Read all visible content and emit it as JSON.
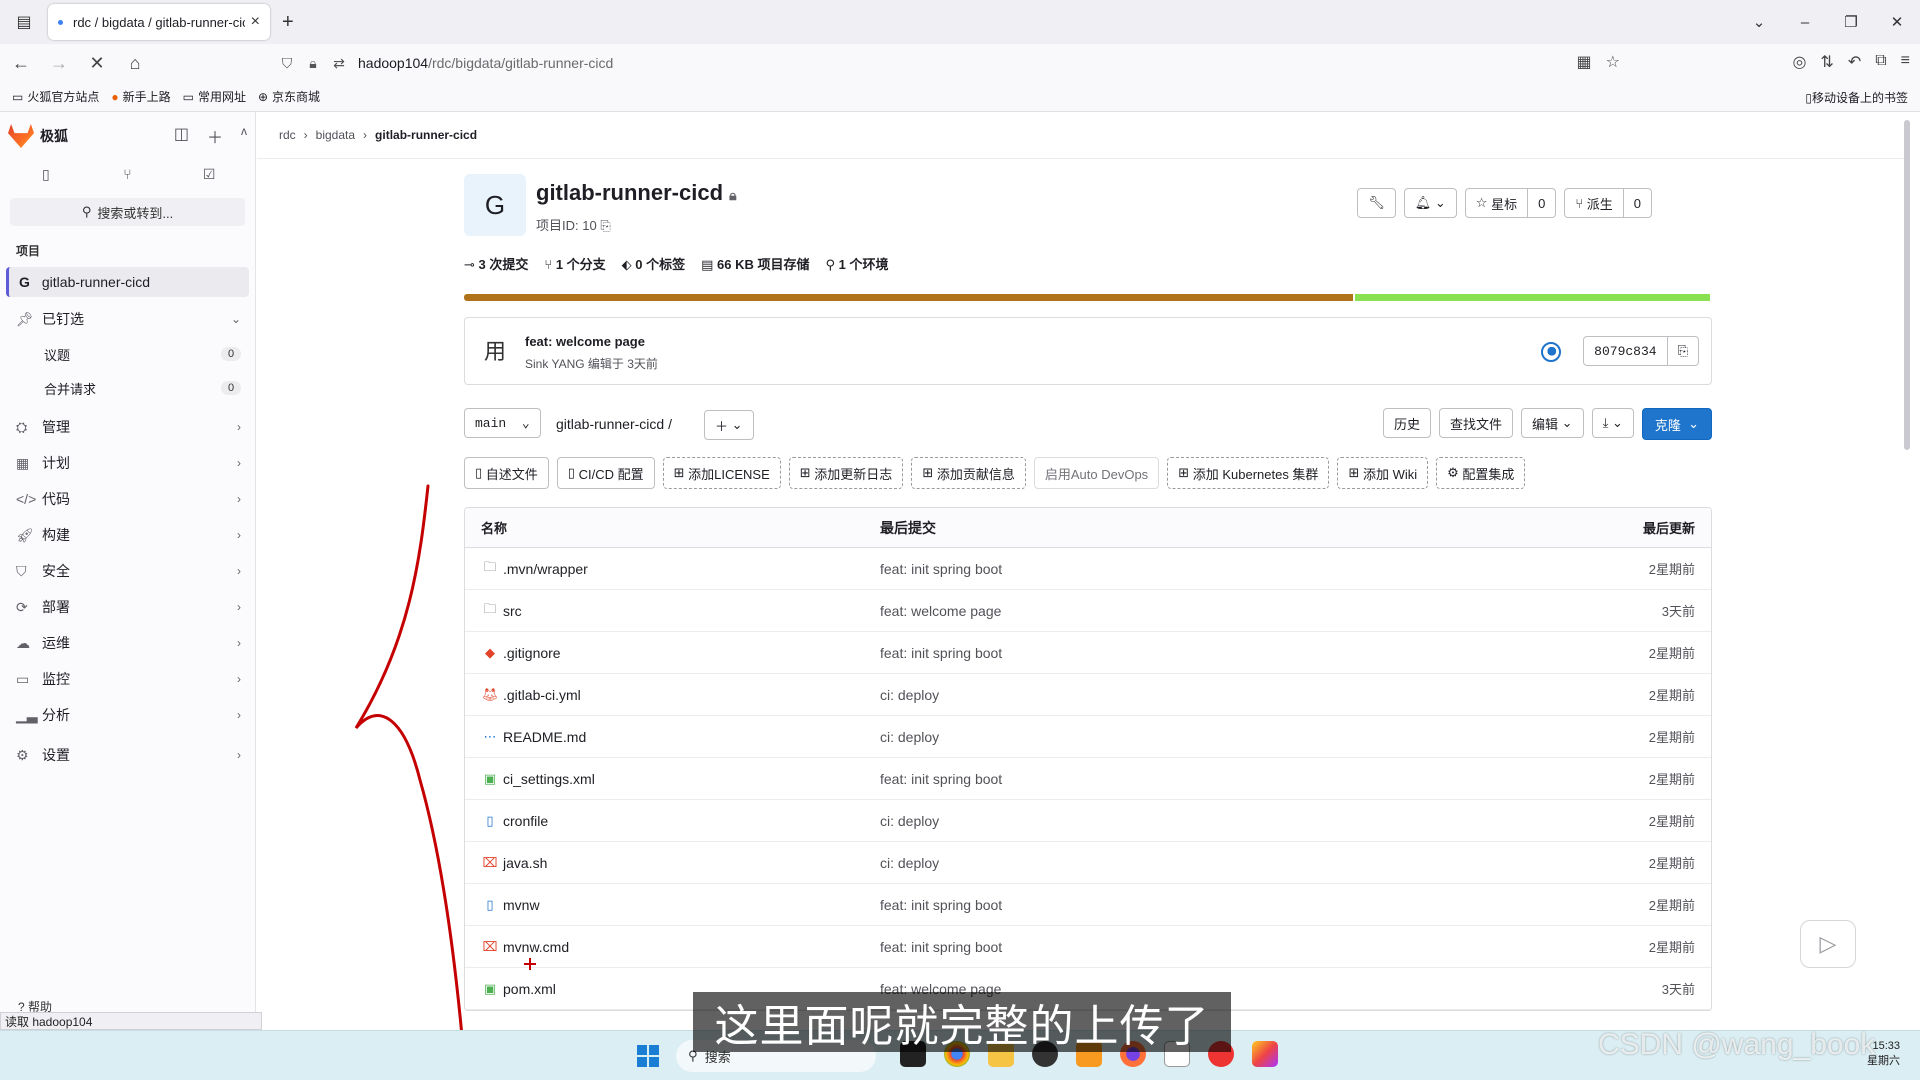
{
  "browser": {
    "tab_title": "rdc / bigdata / gitlab-runner-cicd",
    "url_host": "hadoop104",
    "url_path": "/rdc/bigdata/gitlab-runner-cicd",
    "bookmarks": [
      "火狐官方站点",
      "新手上路",
      "常用网址",
      "京东商城"
    ],
    "bookmarks_right": "移动设备上的书签",
    "status_text": "读取 hadoop104"
  },
  "sidebar": {
    "brand": "极狐",
    "search_placeholder": "搜索或转到...",
    "section_label": "项目",
    "project_initial": "G",
    "project_name": "gitlab-runner-cicd",
    "pinned_label": "已钉选",
    "pinned_items": [
      {
        "label": "议题",
        "count": "0"
      },
      {
        "label": "合并请求",
        "count": "0"
      }
    ],
    "items": [
      {
        "label": "管理",
        "icon": "manage-icon"
      },
      {
        "label": "计划",
        "icon": "plan-icon"
      },
      {
        "label": "代码",
        "icon": "code-icon"
      },
      {
        "label": "构建",
        "icon": "build-icon"
      },
      {
        "label": "安全",
        "icon": "shield-icon"
      },
      {
        "label": "部署",
        "icon": "deploy-icon"
      },
      {
        "label": "运维",
        "icon": "operate-icon"
      },
      {
        "label": "监控",
        "icon": "monitor-icon"
      },
      {
        "label": "分析",
        "icon": "analytics-icon"
      },
      {
        "label": "设置",
        "icon": "settings-icon"
      }
    ],
    "help_label": "帮助"
  },
  "breadcrumb": [
    "rdc",
    "bigdata",
    "gitlab-runner-cicd"
  ],
  "project": {
    "avatar_initial": "G",
    "title": "gitlab-runner-cicd",
    "id_label": "项目ID: 10",
    "star_label": "星标",
    "star_count": "0",
    "fork_label": "派生",
    "fork_count": "0",
    "stats": {
      "commits": "3 次提交",
      "branches": "1 个分支",
      "tags": "0 个标签",
      "storage": "66 KB 项目存储",
      "environments": "1 个环境"
    },
    "language_bar": [
      {
        "share": 0.715,
        "color": "#b07219"
      },
      {
        "share": 0.285,
        "color": "#89e051"
      }
    ]
  },
  "last_commit": {
    "avatar_text": "用",
    "message": "feat: welcome page",
    "meta": "Sink YANG 编辑于 3天前",
    "sha": "8079c834"
  },
  "repo": {
    "branch": "main",
    "path": "gitlab-runner-cicd",
    "path_sep": "/",
    "history": "历史",
    "find_file": "查找文件",
    "edit": "编辑",
    "clone": "克隆"
  },
  "quick_actions": [
    {
      "label": "自述文件",
      "style": "solid"
    },
    {
      "label": "CI/CD 配置",
      "style": "solid"
    },
    {
      "label": "添加LICENSE",
      "style": "dashed"
    },
    {
      "label": "添加更新日志",
      "style": "dashed"
    },
    {
      "label": "添加贡献信息",
      "style": "dashed"
    },
    {
      "label": "启用Auto DevOps",
      "style": "ghost"
    },
    {
      "label": "添加 Kubernetes 集群",
      "style": "dashed"
    },
    {
      "label": "添加 Wiki",
      "style": "dashed"
    },
    {
      "label": "配置集成",
      "style": "dashed"
    }
  ],
  "files": {
    "headers": {
      "name": "名称",
      "commit": "最后提交",
      "date": "最后更新"
    },
    "rows": [
      {
        "name": ".mvn/wrapper",
        "icon": "folder-icon",
        "commit": "feat: init spring boot",
        "date": "2星期前"
      },
      {
        "name": "src",
        "icon": "folder-icon",
        "commit": "feat: welcome page",
        "date": "3天前"
      },
      {
        "name": ".gitignore",
        "icon": "git-icon",
        "commit": "feat: init spring boot",
        "date": "2星期前"
      },
      {
        "name": ".gitlab-ci.yml",
        "icon": "gitlab-icon",
        "commit": "ci: deploy",
        "date": "2星期前"
      },
      {
        "name": "README.md",
        "icon": "markdown-icon",
        "commit": "ci: deploy",
        "date": "2星期前"
      },
      {
        "name": "ci_settings.xml",
        "icon": "xml-icon",
        "commit": "feat: init spring boot",
        "date": "2星期前"
      },
      {
        "name": "cronfile",
        "icon": "file-icon",
        "commit": "ci: deploy",
        "date": "2星期前"
      },
      {
        "name": "java.sh",
        "icon": "terminal-icon",
        "commit": "ci: deploy",
        "date": "2星期前"
      },
      {
        "name": "mvnw",
        "icon": "file-icon",
        "commit": "feat: init spring boot",
        "date": "2星期前"
      },
      {
        "name": "mvnw.cmd",
        "icon": "terminal-icon",
        "commit": "feat: init spring boot",
        "date": "2星期前"
      },
      {
        "name": "pom.xml",
        "icon": "xml-icon",
        "commit": "feat: welcome page",
        "date": "3天前"
      }
    ]
  },
  "taskbar": {
    "search_label": "搜索",
    "time": "15:33",
    "day": "星期六"
  },
  "overlay": {
    "subtitle": "这里面呢就完整的上传了",
    "watermark": "CSDN @wang_book"
  },
  "colors": {
    "accent": "#1f75cb",
    "annotation": "#c40000",
    "language_java": "#b07219",
    "language_shell": "#89e051"
  }
}
